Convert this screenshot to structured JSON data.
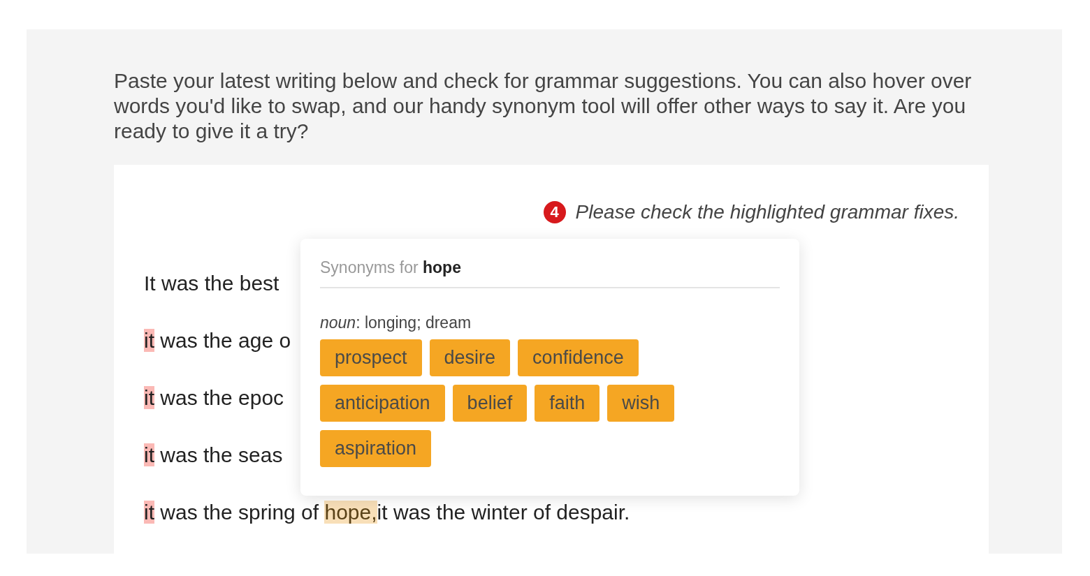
{
  "intro": "Paste your latest writing below and check for grammar suggestions. You can also hover over words you'd like to swap, and our handy synonym tool will offer other ways to say it. Are you ready to give it a try?",
  "editor": {
    "issue_count": "4",
    "message": "Please check the highlighted grammar fixes.",
    "lines": [
      [
        {
          "kind": "plain",
          "text": "It was the best"
        }
      ],
      [
        {
          "kind": "grammar",
          "text": "it"
        },
        {
          "kind": "plain",
          "text": " was the age o"
        }
      ],
      [
        {
          "kind": "grammar",
          "text": "it"
        },
        {
          "kind": "plain",
          "text": " was the epoc"
        }
      ],
      [
        {
          "kind": "grammar",
          "text": "it"
        },
        {
          "kind": "plain",
          "text": " was the seas"
        }
      ],
      [
        {
          "kind": "grammar",
          "text": "it"
        },
        {
          "kind": "plain",
          "text": " was the spring of "
        },
        {
          "kind": "synonym",
          "text": "hope,"
        },
        {
          "kind": "plain",
          "text": "it was the winter of despair."
        }
      ]
    ]
  },
  "synonyms_popup": {
    "title": "Synonyms for **hope**",
    "definition": "*noun*: longing; dream",
    "options": [
      "prospect",
      "desire",
      "confidence",
      "anticipation",
      "belief",
      "faith",
      "wish",
      "aspiration"
    ]
  }
}
